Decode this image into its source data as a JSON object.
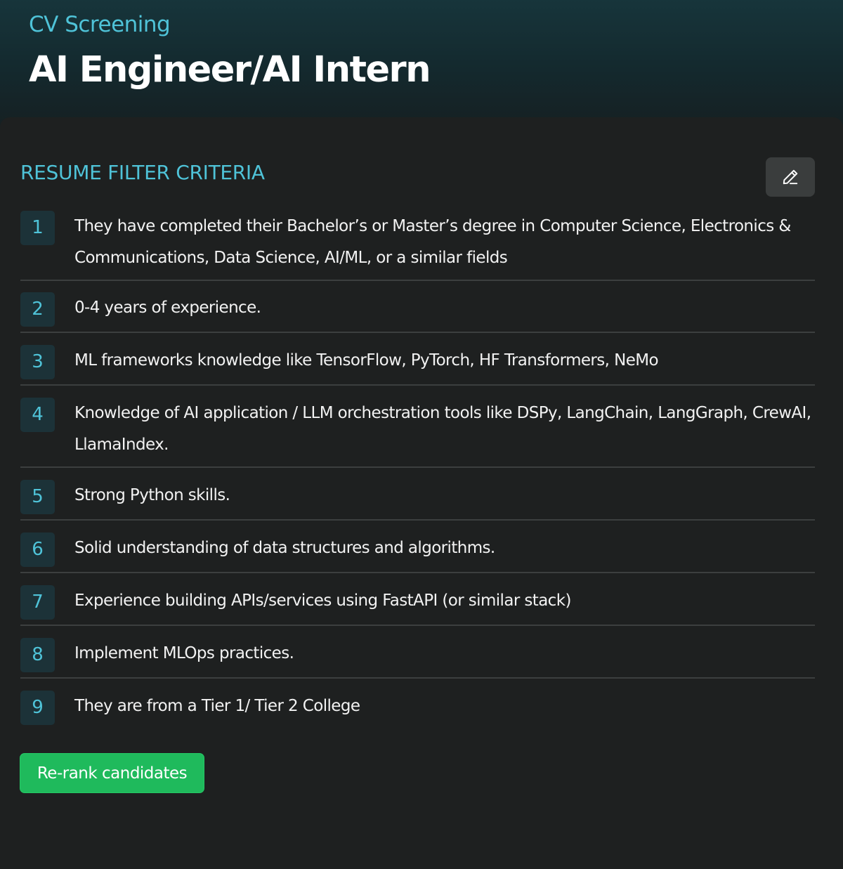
{
  "header": {
    "subtitle": "CV Screening",
    "title": "AI Engineer/AI Intern"
  },
  "criteria_section": {
    "heading": "RESUME FILTER CRITERIA",
    "edit_icon": "pencil-icon",
    "items": [
      {
        "number": "1",
        "text": "They have completed their Bachelor’s or Master’s degree in Computer Science, Electronics & Communications, Data Science, AI/ML, or a similar fields"
      },
      {
        "number": "2",
        "text": "0-4 years of experience."
      },
      {
        "number": "3",
        "text": "ML frameworks knowledge like TensorFlow, PyTorch, HF Transformers, NeMo"
      },
      {
        "number": "4",
        "text": "Knowledge of AI application / LLM orchestration tools like DSPy, LangChain, LangGraph, CrewAI, LlamaIndex."
      },
      {
        "number": "5",
        "text": "Strong Python skills."
      },
      {
        "number": "6",
        "text": "Solid understanding of data structures and algorithms."
      },
      {
        "number": "7",
        "text": "Experience building APIs/services using FastAPI (or similar stack)"
      },
      {
        "number": "8",
        "text": "Implement MLOps practices."
      },
      {
        "number": "9",
        "text": "They are from a Tier 1/ Tier 2 College"
      }
    ],
    "rerank_label": "Re-rank candidates"
  },
  "colors": {
    "accent": "#4fc3d8",
    "background": "#1e2020",
    "button_green": "#1fba5c",
    "badge_bg": "#1c3238"
  }
}
